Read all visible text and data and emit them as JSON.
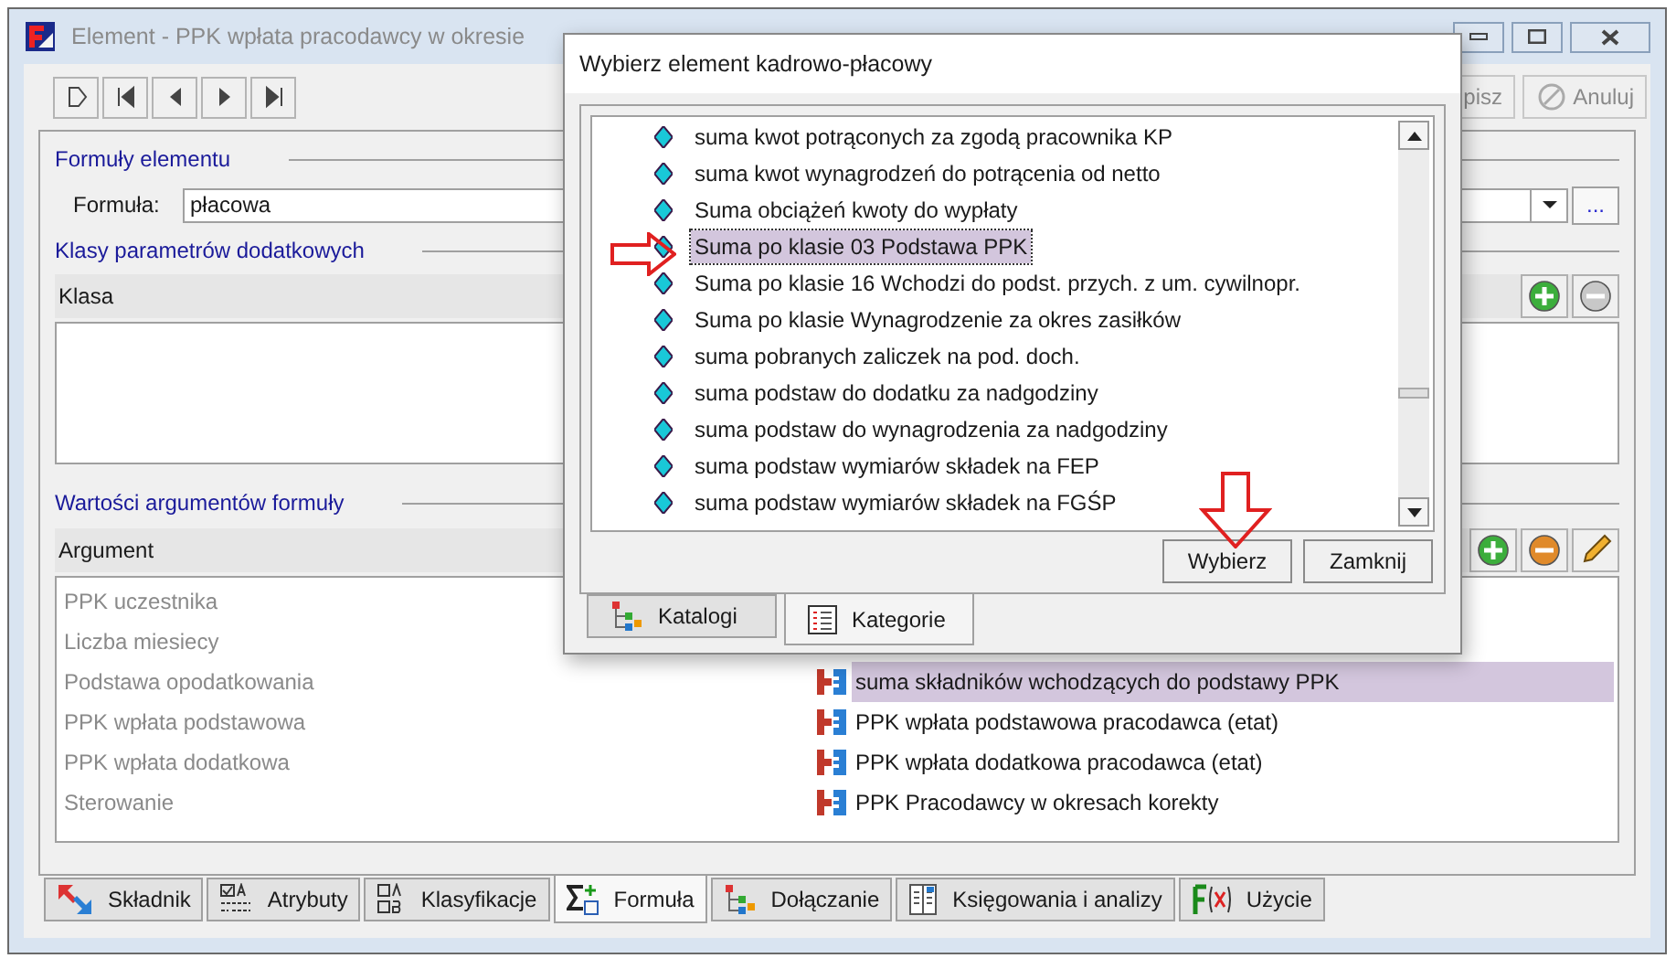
{
  "window": {
    "title": "Element - PPK wpłata pracodawcy w okresie"
  },
  "actions": [
    {
      "label": "pisz",
      "kind": "save"
    },
    {
      "label": "Anuluj",
      "kind": "cancel"
    }
  ],
  "formula_section": {
    "title": "Formuły elementu",
    "label": "Formuła:",
    "value": "płacowa",
    "browse": "..."
  },
  "classes_section": {
    "title": "Klasy parametrów dodatkowych",
    "column": "Klasa"
  },
  "arguments_section": {
    "title": "Wartości argumentów formuły",
    "column": "Argument",
    "rows": [
      {
        "name": "PPK uczestnika",
        "selected": false
      },
      {
        "name": "Liczba miesiecy",
        "selected": false
      },
      {
        "name": "Podstawa opodatkowania",
        "value": "suma składników wchodzących do podstawy PPK",
        "selected": true
      },
      {
        "name": "PPK wpłata podstawowa",
        "value": "PPK wpłata podstawowa pracodawca (etat)",
        "selected": false
      },
      {
        "name": "PPK wpłata dodatkowa",
        "value": "PPK wpłata dodatkowa pracodawca (etat)",
        "selected": false
      },
      {
        "name": "Sterowanie",
        "value": "PPK Pracodawcy w okresach korekty",
        "selected": false
      }
    ]
  },
  "tabs": [
    {
      "label": "Składnik",
      "kind": "component",
      "selected": false
    },
    {
      "label": "Atrybuty",
      "kind": "attributes",
      "selected": false
    },
    {
      "label": "Klasyfikacje",
      "kind": "classification",
      "selected": false
    },
    {
      "label": "Formuła",
      "kind": "formula",
      "selected": true
    },
    {
      "label": "Dołączanie",
      "kind": "tree",
      "selected": false
    },
    {
      "label": "Księgowania i analizy",
      "kind": "ledger",
      "selected": false
    },
    {
      "label": "Użycie",
      "kind": "function",
      "selected": false
    }
  ],
  "dialog": {
    "title": "Wybierz element kadrowo-płacowy",
    "items": [
      {
        "label": "suma kwot potrąconych za zgodą pracownika KP",
        "selected": false
      },
      {
        "label": "suma kwot wynagrodzeń do potrącenia od netto",
        "selected": false
      },
      {
        "label": "Suma obciążeń kwoty do wypłaty",
        "selected": false
      },
      {
        "label": "Suma po klasie 03 Podstawa PPK",
        "selected": true
      },
      {
        "label": "Suma po klasie 16 Wchodzi do podst. przych. z um. cywilnopr.",
        "selected": false
      },
      {
        "label": "Suma po klasie Wynagrodzenie za okres zasiłków",
        "selected": false
      },
      {
        "label": "suma pobranych zaliczek na pod. doch.",
        "selected": false
      },
      {
        "label": "suma podstaw do dodatku za nadgodziny",
        "selected": false
      },
      {
        "label": "suma podstaw do wynagrodzenia za nadgodziny",
        "selected": false
      },
      {
        "label": "suma podstaw wymiarów składek na FEP",
        "selected": false
      },
      {
        "label": "suma podstaw wymiarów składek na FGŚP",
        "selected": false
      }
    ],
    "buttons": [
      "Wybierz",
      "Zamknij"
    ],
    "tabs": [
      {
        "label": "Katalogi",
        "kind": "tree",
        "selected": false
      },
      {
        "label": "Kategorie",
        "kind": "list",
        "selected": true
      }
    ]
  }
}
